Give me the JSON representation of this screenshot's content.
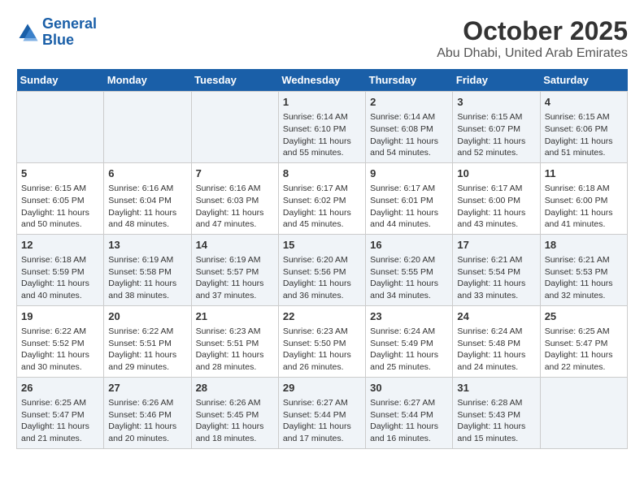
{
  "logo": {
    "text_general": "General",
    "text_blue": "Blue"
  },
  "title": "October 2025",
  "subtitle": "Abu Dhabi, United Arab Emirates",
  "days_of_week": [
    "Sunday",
    "Monday",
    "Tuesday",
    "Wednesday",
    "Thursday",
    "Friday",
    "Saturday"
  ],
  "weeks": [
    [
      {
        "day": "",
        "content": ""
      },
      {
        "day": "",
        "content": ""
      },
      {
        "day": "",
        "content": ""
      },
      {
        "day": "1",
        "content": "Sunrise: 6:14 AM\nSunset: 6:10 PM\nDaylight: 11 hours\nand 55 minutes."
      },
      {
        "day": "2",
        "content": "Sunrise: 6:14 AM\nSunset: 6:08 PM\nDaylight: 11 hours\nand 54 minutes."
      },
      {
        "day": "3",
        "content": "Sunrise: 6:15 AM\nSunset: 6:07 PM\nDaylight: 11 hours\nand 52 minutes."
      },
      {
        "day": "4",
        "content": "Sunrise: 6:15 AM\nSunset: 6:06 PM\nDaylight: 11 hours\nand 51 minutes."
      }
    ],
    [
      {
        "day": "5",
        "content": "Sunrise: 6:15 AM\nSunset: 6:05 PM\nDaylight: 11 hours\nand 50 minutes."
      },
      {
        "day": "6",
        "content": "Sunrise: 6:16 AM\nSunset: 6:04 PM\nDaylight: 11 hours\nand 48 minutes."
      },
      {
        "day": "7",
        "content": "Sunrise: 6:16 AM\nSunset: 6:03 PM\nDaylight: 11 hours\nand 47 minutes."
      },
      {
        "day": "8",
        "content": "Sunrise: 6:17 AM\nSunset: 6:02 PM\nDaylight: 11 hours\nand 45 minutes."
      },
      {
        "day": "9",
        "content": "Sunrise: 6:17 AM\nSunset: 6:01 PM\nDaylight: 11 hours\nand 44 minutes."
      },
      {
        "day": "10",
        "content": "Sunrise: 6:17 AM\nSunset: 6:00 PM\nDaylight: 11 hours\nand 43 minutes."
      },
      {
        "day": "11",
        "content": "Sunrise: 6:18 AM\nSunset: 6:00 PM\nDaylight: 11 hours\nand 41 minutes."
      }
    ],
    [
      {
        "day": "12",
        "content": "Sunrise: 6:18 AM\nSunset: 5:59 PM\nDaylight: 11 hours\nand 40 minutes."
      },
      {
        "day": "13",
        "content": "Sunrise: 6:19 AM\nSunset: 5:58 PM\nDaylight: 11 hours\nand 38 minutes."
      },
      {
        "day": "14",
        "content": "Sunrise: 6:19 AM\nSunset: 5:57 PM\nDaylight: 11 hours\nand 37 minutes."
      },
      {
        "day": "15",
        "content": "Sunrise: 6:20 AM\nSunset: 5:56 PM\nDaylight: 11 hours\nand 36 minutes."
      },
      {
        "day": "16",
        "content": "Sunrise: 6:20 AM\nSunset: 5:55 PM\nDaylight: 11 hours\nand 34 minutes."
      },
      {
        "day": "17",
        "content": "Sunrise: 6:21 AM\nSunset: 5:54 PM\nDaylight: 11 hours\nand 33 minutes."
      },
      {
        "day": "18",
        "content": "Sunrise: 6:21 AM\nSunset: 5:53 PM\nDaylight: 11 hours\nand 32 minutes."
      }
    ],
    [
      {
        "day": "19",
        "content": "Sunrise: 6:22 AM\nSunset: 5:52 PM\nDaylight: 11 hours\nand 30 minutes."
      },
      {
        "day": "20",
        "content": "Sunrise: 6:22 AM\nSunset: 5:51 PM\nDaylight: 11 hours\nand 29 minutes."
      },
      {
        "day": "21",
        "content": "Sunrise: 6:23 AM\nSunset: 5:51 PM\nDaylight: 11 hours\nand 28 minutes."
      },
      {
        "day": "22",
        "content": "Sunrise: 6:23 AM\nSunset: 5:50 PM\nDaylight: 11 hours\nand 26 minutes."
      },
      {
        "day": "23",
        "content": "Sunrise: 6:24 AM\nSunset: 5:49 PM\nDaylight: 11 hours\nand 25 minutes."
      },
      {
        "day": "24",
        "content": "Sunrise: 6:24 AM\nSunset: 5:48 PM\nDaylight: 11 hours\nand 24 minutes."
      },
      {
        "day": "25",
        "content": "Sunrise: 6:25 AM\nSunset: 5:47 PM\nDaylight: 11 hours\nand 22 minutes."
      }
    ],
    [
      {
        "day": "26",
        "content": "Sunrise: 6:25 AM\nSunset: 5:47 PM\nDaylight: 11 hours\nand 21 minutes."
      },
      {
        "day": "27",
        "content": "Sunrise: 6:26 AM\nSunset: 5:46 PM\nDaylight: 11 hours\nand 20 minutes."
      },
      {
        "day": "28",
        "content": "Sunrise: 6:26 AM\nSunset: 5:45 PM\nDaylight: 11 hours\nand 18 minutes."
      },
      {
        "day": "29",
        "content": "Sunrise: 6:27 AM\nSunset: 5:44 PM\nDaylight: 11 hours\nand 17 minutes."
      },
      {
        "day": "30",
        "content": "Sunrise: 6:27 AM\nSunset: 5:44 PM\nDaylight: 11 hours\nand 16 minutes."
      },
      {
        "day": "31",
        "content": "Sunrise: 6:28 AM\nSunset: 5:43 PM\nDaylight: 11 hours\nand 15 minutes."
      },
      {
        "day": "",
        "content": ""
      }
    ]
  ]
}
